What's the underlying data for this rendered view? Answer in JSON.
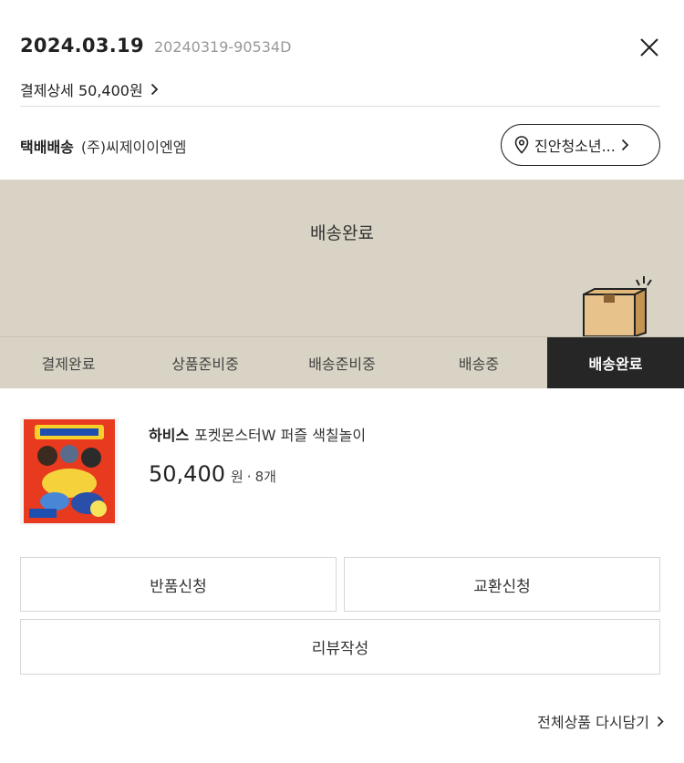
{
  "order": {
    "date": "2024.03.19",
    "number": "20240319-90534D",
    "payment_link_label": "결제상세 50,400원"
  },
  "shipping": {
    "type": "택배배송",
    "carrier": "(주)씨제이이엔엠",
    "address_label": "진안청소년..."
  },
  "status": {
    "title": "배송완료",
    "steps": [
      "결제완료",
      "상품준비중",
      "배송준비중",
      "배송중",
      "배송완료"
    ],
    "active_step": 4
  },
  "product": {
    "brand": "하비스",
    "name": "포켓몬스터W 퍼즐 색칠놀이",
    "price": "50,400",
    "price_unit": "원",
    "quantity": "8개"
  },
  "actions": {
    "return_label": "반품신청",
    "exchange_label": "교환신청",
    "review_label": "리뷰작성",
    "rebuy_label": "전체상품 다시담기"
  },
  "icons": {
    "close": "close-icon",
    "chevron": "chevron-right-icon",
    "location": "location-pin-icon",
    "box": "package-box-icon"
  },
  "colors": {
    "status_bg": "#d8d3c4",
    "active_step_bg": "#262626",
    "text": "#222222"
  }
}
